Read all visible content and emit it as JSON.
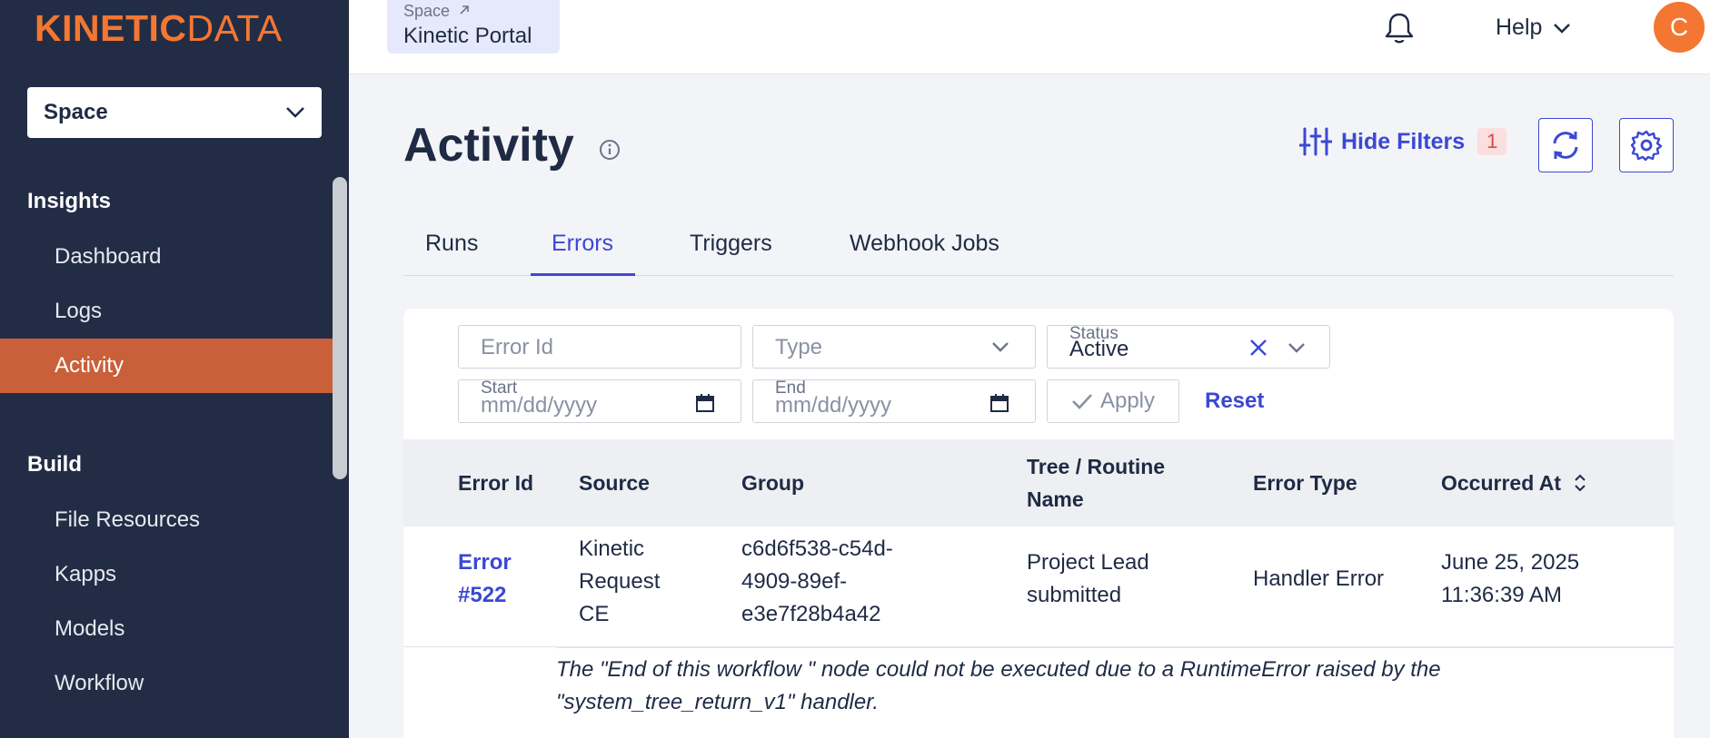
{
  "brand": {
    "logo_bold": "KINETIC",
    "logo_light": "DATA"
  },
  "sidebar": {
    "space_select": "Space",
    "insights_heading": "Insights",
    "insights_items": [
      {
        "label": "Dashboard"
      },
      {
        "label": "Logs"
      },
      {
        "label": "Activity",
        "active": true
      }
    ],
    "build_heading": "Build",
    "build_items": [
      {
        "label": "File Resources"
      },
      {
        "label": "Kapps"
      },
      {
        "label": "Models"
      },
      {
        "label": "Workflow"
      }
    ]
  },
  "topbar": {
    "breadcrumb_small": "Space",
    "breadcrumb_title": "Kinetic Portal",
    "help_label": "Help",
    "avatar_initial": "C"
  },
  "header": {
    "title": "Activity",
    "hide_filters_label": "Hide Filters",
    "filter_count": "1"
  },
  "tabs": [
    {
      "label": "Runs"
    },
    {
      "label": "Errors",
      "active": true
    },
    {
      "label": "Triggers"
    },
    {
      "label": "Webhook Jobs"
    }
  ],
  "filters": {
    "error_id_placeholder": "Error Id",
    "type_placeholder": "Type",
    "status_label": "Status",
    "status_value": "Active",
    "start_label": "Start",
    "start_placeholder": "mm/dd/yyyy",
    "end_label": "End",
    "end_placeholder": "mm/dd/yyyy",
    "apply_label": "Apply",
    "reset_label": "Reset"
  },
  "table": {
    "headers": {
      "error_id": "Error Id",
      "source": "Source",
      "group": "Group",
      "tree_line1": "Tree / Routine",
      "tree_line2": "Name",
      "error_type": "Error Type",
      "occurred_at": "Occurred At"
    },
    "rows": [
      {
        "error_id_line1": "Error",
        "error_id_line2": "#522",
        "source_line1": "Kinetic",
        "source_line2": "Request",
        "source_line3": "CE",
        "group_line1": "c6d6f538-c54d-",
        "group_line2": "4909-89ef-",
        "group_line3": "e3e7f28b4a42",
        "tree_line1": "Project Lead",
        "tree_line2": "submitted",
        "error_type": "Handler Error",
        "occurred_line1": "June 25, 2025",
        "occurred_line2": "11:36:39 AM",
        "message_line1": "The \"End of this workflow \" node could not be executed due to a RuntimeError raised by the",
        "message_line2": "\"system_tree_return_v1\" handler."
      }
    ]
  },
  "colors": {
    "sidebar_bg": "#222d45",
    "accent_orange": "#f37732",
    "active_item": "#c9603a",
    "link_blue": "#3b48d4"
  }
}
